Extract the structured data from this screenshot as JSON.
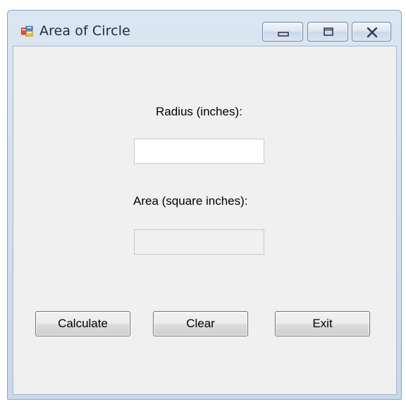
{
  "window": {
    "title": "Area of Circle",
    "icon": "windows-form-icon",
    "controls": {
      "minimize_icon": "minimize-icon",
      "maximize_icon": "maximize-icon",
      "close_icon": "close-icon"
    }
  },
  "form": {
    "radius_label": "Radius (inches):",
    "radius_value": "",
    "area_label": "Area (square inches):",
    "area_value": "",
    "buttons": {
      "calculate": "Calculate",
      "clear": "Clear",
      "exit": "Exit"
    }
  },
  "colors": {
    "client_background": "#f0f0f0",
    "titlebar": "#c9d8ea"
  }
}
